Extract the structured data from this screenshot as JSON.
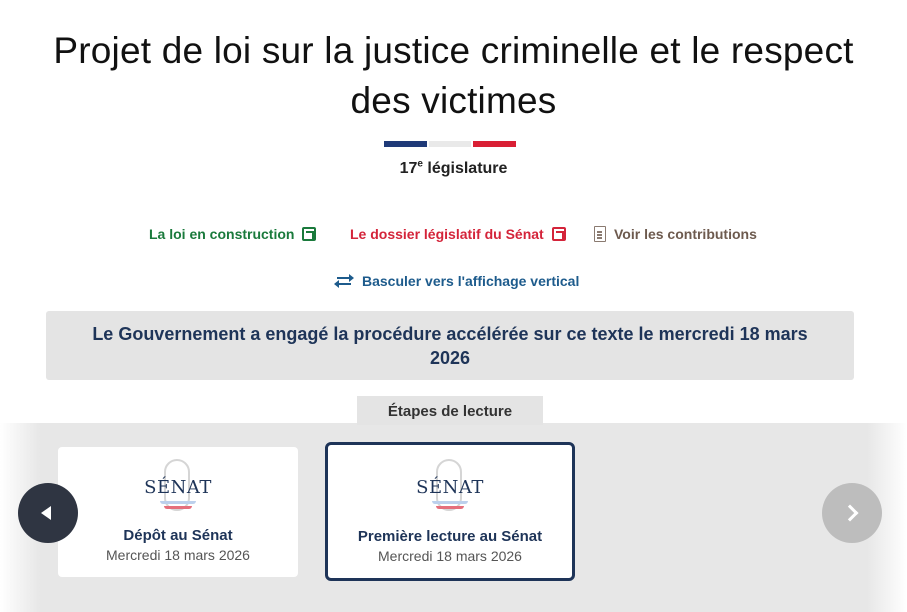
{
  "title": "Projet de loi sur la justice criminelle et le respect des victimes",
  "legislature": {
    "number": "17",
    "suffix": "e",
    "label": "législature"
  },
  "links": {
    "loi_construction": "La loi en construction",
    "dossier_senat": "Le dossier législatif du Sénat",
    "contributions": "Voir les contributions"
  },
  "toggle_label": "Basculer vers l'affichage vertical",
  "procedure_banner": "Le Gouvernement a engagé la procédure accélérée sur ce texte le mercredi 18 mars 2026",
  "etapes_tab": "Étapes de lecture",
  "steps": [
    {
      "logo": "SÉNAT",
      "title": "Dépôt au Sénat",
      "date": "Mercredi 18 mars 2026"
    },
    {
      "logo": "SÉNAT",
      "title": "Première lecture au Sénat",
      "date": "Mercredi 18 mars 2026"
    }
  ],
  "icons": {
    "external": "external-link-icon",
    "document": "document-icon",
    "swap": "swap-arrows-icon",
    "prev": "arrow-left-icon",
    "next": "chevron-right-icon"
  },
  "colors": {
    "flag_blue": "#1f3a78",
    "flag_red": "#d91f34",
    "green_link": "#1a7a3c",
    "red_link": "#d4243a",
    "navy": "#1e3458"
  }
}
